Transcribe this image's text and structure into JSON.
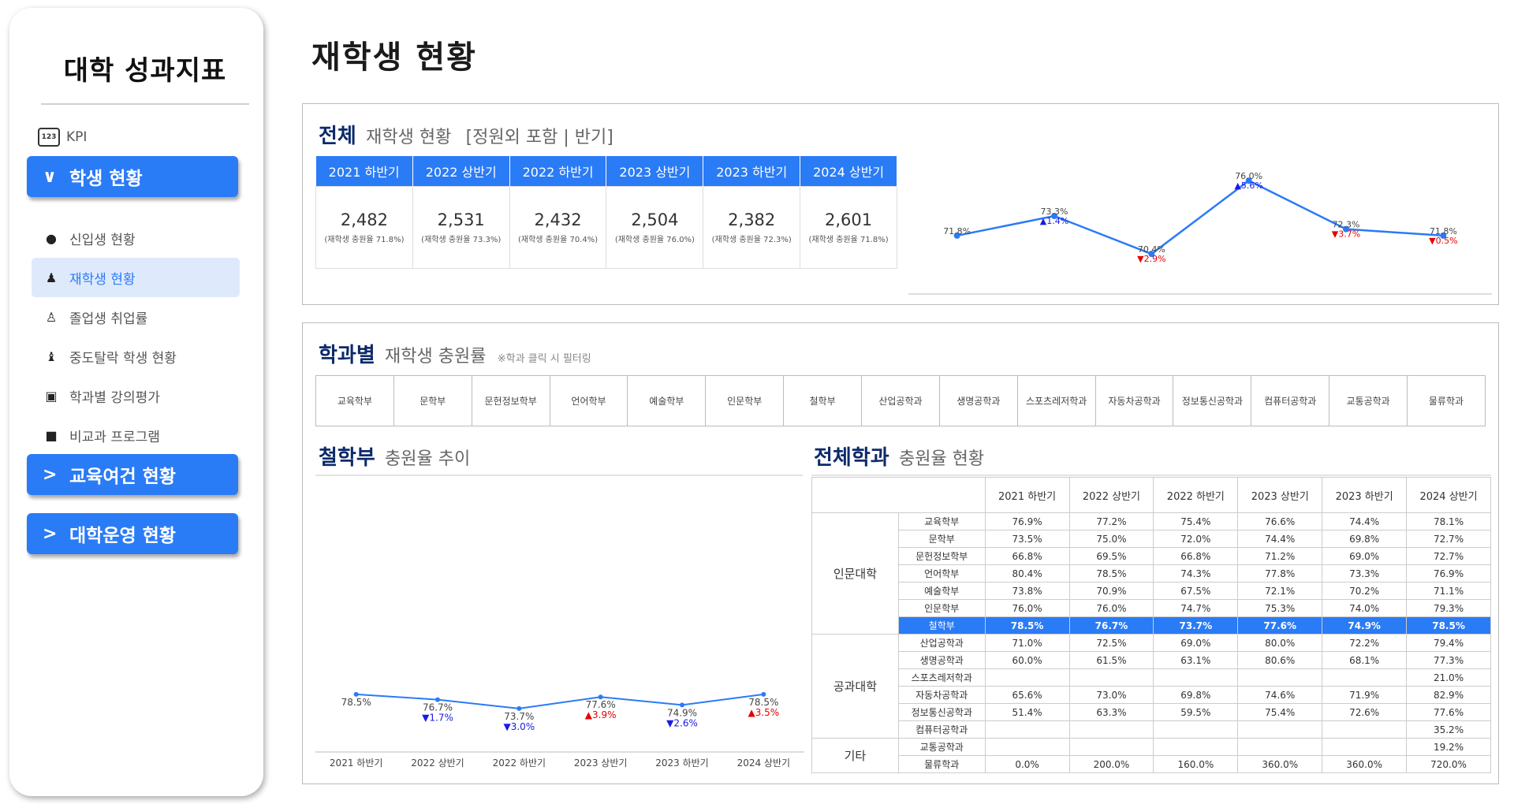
{
  "sidebar": {
    "brand": "대학 성과지표",
    "kpi_label": "KPI",
    "kpi_icon": "123",
    "menu1": "학생 현황",
    "items": [
      {
        "label": "신입생 현황",
        "icon": "person-icon"
      },
      {
        "label": "재학생 현황",
        "icon": "group-icon"
      },
      {
        "label": "졸업생 취업률",
        "icon": "person-tie-icon"
      },
      {
        "label": "중도탈락 학생 현황",
        "icon": "graduate-icon"
      },
      {
        "label": "학과별 강의평가",
        "icon": "monitor-icon"
      },
      {
        "label": "비교과 프로그램",
        "icon": "book-icon"
      }
    ],
    "menu2": "교육여건 현황",
    "menu3": "대학운영 현황",
    "accent": "#2a7bf6"
  },
  "page": {
    "title": "재학생 현황"
  },
  "overview": {
    "title_bold": "전체",
    "title_rest": "재학생 현황",
    "title_suffix": "[정원외 포함 | 반기]",
    "periods": [
      "2021 하반기",
      "2022 상반기",
      "2022 하반기",
      "2023 상반기",
      "2023 하반기",
      "2024 상반기"
    ],
    "counts": [
      "2,482",
      "2,531",
      "2,432",
      "2,504",
      "2,382",
      "2,601"
    ],
    "rate_notes": [
      "(재학생 충원율 71.8%)",
      "(재학생 충원율 73.3%)",
      "(재학생 충원율 70.4%)",
      "(재학생 충원율 76.0%)",
      "(재학생 충원율 72.3%)",
      "(재학생 충원율 71.8%)"
    ]
  },
  "dept": {
    "title_bold": "학과별",
    "title_rest": "재학생 충원률",
    "note": "※학과 클릭 시 필터링",
    "list": [
      "교육학부",
      "문학부",
      "문헌정보학부",
      "언어학부",
      "예술학부",
      "인문학부",
      "철학부",
      "산업공학과",
      "생명공학과",
      "스포츠레저학과",
      "자동차공학과",
      "정보통신공학과",
      "컴퓨터공학과",
      "교통공학과",
      "물류학과"
    ]
  },
  "trend": {
    "title_bold": "철학부",
    "title_rest": "충원율 추이"
  },
  "table": {
    "title_bold": "전체학과",
    "title_rest": "충원율 현황",
    "headers": [
      "2021 하반기",
      "2022 상반기",
      "2022 하반기",
      "2023 상반기",
      "2023 하반기",
      "2024 상반기"
    ],
    "groups": [
      {
        "name": "인문대학",
        "rows": [
          {
            "dept": "교육학부",
            "vals": [
              "76.9%",
              "77.2%",
              "75.4%",
              "76.6%",
              "74.4%",
              "78.1%"
            ]
          },
          {
            "dept": "문학부",
            "vals": [
              "73.5%",
              "75.0%",
              "72.0%",
              "74.4%",
              "69.8%",
              "72.7%"
            ]
          },
          {
            "dept": "문헌정보학부",
            "vals": [
              "66.8%",
              "69.5%",
              "66.8%",
              "71.2%",
              "69.0%",
              "72.7%"
            ]
          },
          {
            "dept": "언어학부",
            "vals": [
              "80.4%",
              "78.5%",
              "74.3%",
              "77.8%",
              "73.3%",
              "76.9%"
            ]
          },
          {
            "dept": "예술학부",
            "vals": [
              "73.8%",
              "70.9%",
              "67.5%",
              "72.1%",
              "70.2%",
              "71.1%"
            ]
          },
          {
            "dept": "인문학부",
            "vals": [
              "76.0%",
              "76.0%",
              "74.7%",
              "75.3%",
              "74.0%",
              "79.3%"
            ]
          },
          {
            "dept": "철학부",
            "vals": [
              "78.5%",
              "76.7%",
              "73.7%",
              "77.6%",
              "74.9%",
              "78.5%"
            ],
            "highlight": true
          }
        ]
      },
      {
        "name": "공과대학",
        "rows": [
          {
            "dept": "산업공학과",
            "vals": [
              "71.0%",
              "72.5%",
              "69.0%",
              "80.0%",
              "72.2%",
              "79.4%"
            ]
          },
          {
            "dept": "생명공학과",
            "vals": [
              "60.0%",
              "61.5%",
              "63.1%",
              "80.6%",
              "68.1%",
              "77.3%"
            ]
          },
          {
            "dept": "스포츠레저학과",
            "vals": [
              "",
              "",
              "",
              "",
              "",
              "21.0%"
            ]
          },
          {
            "dept": "자동차공학과",
            "vals": [
              "65.6%",
              "73.0%",
              "69.8%",
              "74.6%",
              "71.9%",
              "82.9%"
            ]
          },
          {
            "dept": "정보통신공학과",
            "vals": [
              "51.4%",
              "63.3%",
              "59.5%",
              "75.4%",
              "72.6%",
              "77.6%"
            ]
          },
          {
            "dept": "컴퓨터공학과",
            "vals": [
              "",
              "",
              "",
              "",
              "",
              "35.2%"
            ]
          }
        ]
      },
      {
        "name": "기타",
        "rows": [
          {
            "dept": "교통공학과",
            "vals": [
              "",
              "",
              "",
              "",
              "",
              "19.2%"
            ]
          },
          {
            "dept": "물류학과",
            "vals": [
              "0.0%",
              "200.0%",
              "160.0%",
              "360.0%",
              "360.0%",
              "720.0%"
            ]
          }
        ]
      }
    ]
  },
  "chart_data": [
    {
      "type": "line",
      "categories": [
        "2021 하반기",
        "2022 상반기",
        "2022 하반기",
        "2023 상반기",
        "2023 하반기",
        "2024 상반기"
      ],
      "values": [
        71.8,
        73.3,
        70.4,
        76.0,
        72.3,
        71.8
      ],
      "value_labels": [
        "71.8%",
        "73.3%",
        "70.4%",
        "76.0%",
        "72.3%",
        "71.8%"
      ],
      "changes": [
        "",
        "▲1.4%",
        "▼2.9%",
        "▲5.6%",
        "▼3.7%",
        "▼0.5%"
      ],
      "change_colors": [
        "",
        "#1a1ae6",
        "#e60000",
        "#1a1ae6",
        "#e60000",
        "#e60000"
      ],
      "ylim": [
        68,
        78
      ],
      "line_color": "#2a7bf6"
    },
    {
      "type": "line",
      "categories": [
        "2021 하반기",
        "2022 상반기",
        "2022 하반기",
        "2023 상반기",
        "2023 하반기",
        "2024 상반기"
      ],
      "values": [
        78.5,
        76.7,
        73.7,
        77.6,
        74.9,
        78.5
      ],
      "value_labels": [
        "78.5%",
        "76.7%",
        "73.7%",
        "77.6%",
        "74.9%",
        "78.5%"
      ],
      "changes": [
        "",
        "▼1.7%",
        "▼3.0%",
        "▲3.9%",
        "▼2.6%",
        "▲3.5%"
      ],
      "change_colors": [
        "",
        "#1a1ae6",
        "#1a1ae6",
        "#e60000",
        "#1a1ae6",
        "#e60000"
      ],
      "ylim": [
        0,
        150
      ],
      "line_color": "#2a7bf6"
    }
  ]
}
